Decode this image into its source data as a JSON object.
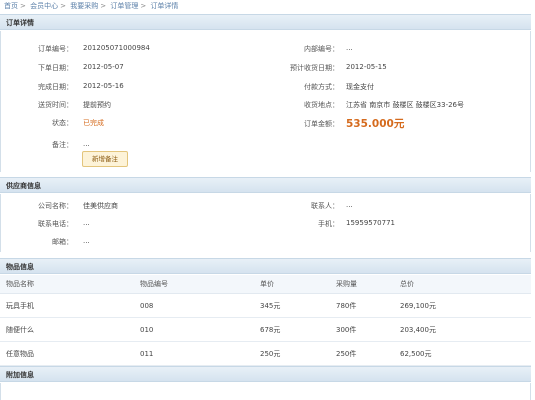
{
  "breadcrumb": [
    "首页",
    "会员中心",
    "我要采购",
    "订单管理",
    "订单详情"
  ],
  "breadcrumb_sep": ">",
  "sections": {
    "order": "订单详情",
    "supplier": "供应商信息",
    "items": "物品信息",
    "extra": "附加信息"
  },
  "order": {
    "order_no_label": "订单编号：",
    "order_no": "201205071000984",
    "place_date_label": "下单日期：",
    "place_date": "2012-05-07",
    "finish_date_label": "完成日期：",
    "finish_date": "2012-05-16",
    "delivery_label": "送货时间：",
    "delivery": "提前预约",
    "status_label": "状态：",
    "status": "已完成",
    "note_label": "备注：",
    "note": "...",
    "add_note_button": "新增备注",
    "internal_no_label": "内部编号：",
    "internal_no": "...",
    "expected_label": "预计收货日期：",
    "expected": "2012-05-15",
    "payment_label": "付款方式：",
    "payment": "现金支付",
    "address_label": "收货地点：",
    "address": "江苏省  南京市  鼓楼区  鼓楼区33-26号",
    "amount_label": "订单金额：",
    "amount": "535.000元"
  },
  "supplier": {
    "company_label": "公司名称：",
    "company": "佳美供应商",
    "contact_label": "联系人：",
    "contact": "...",
    "phone_label": "联系电话：",
    "phone": "...",
    "mobile_label": "手机：",
    "mobile": "15959570771",
    "email_label": "邮箱：",
    "email": "..."
  },
  "items": {
    "columns": [
      "物品名称",
      "物品编号",
      "单价",
      "采购量",
      "总价"
    ],
    "rows": [
      {
        "name": "玩具手机",
        "code": "008",
        "price": "345元",
        "qty": "780件",
        "total": "269,100元"
      },
      {
        "name": "随便什么",
        "code": "010",
        "price": "678元",
        "qty": "300件",
        "total": "203,400元"
      },
      {
        "name": "任意物品",
        "code": "011",
        "price": "250元",
        "qty": "250件",
        "total": "62,500元"
      }
    ]
  },
  "colors": {
    "accent": "#d56b1e",
    "header_bg": "#dce8f2",
    "link": "#5a7fa8"
  }
}
